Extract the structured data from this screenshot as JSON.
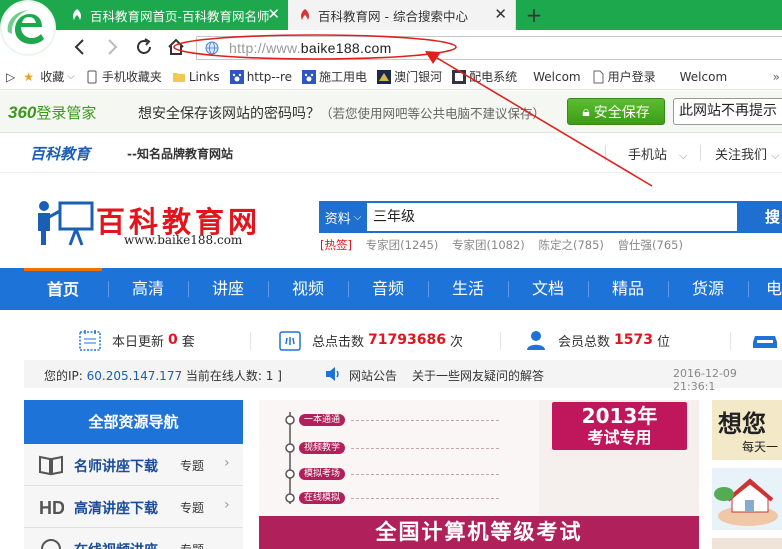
{
  "browser": {
    "tabs": [
      {
        "title": "百科教育网首页-百科教育网名师讲座",
        "active": true
      },
      {
        "title": "百科教育网 - 综合搜索中心",
        "active": false
      }
    ],
    "url_prefix": "http://www.",
    "url_domain": "baike188.com"
  },
  "bookmarks": [
    {
      "label": "收藏",
      "icon": "star-icon"
    },
    {
      "label": "手机收藏夹",
      "icon": "phone-icon"
    },
    {
      "label": "Links",
      "icon": "folder-icon"
    },
    {
      "label": "http--re",
      "icon": "paw-icon"
    },
    {
      "label": "施工用电",
      "icon": "paw-icon"
    },
    {
      "label": "澳门银河",
      "icon": "site-icon"
    },
    {
      "label": "配电系统",
      "icon": "site-icon"
    },
    {
      "label": "Welcom",
      "icon": ""
    },
    {
      "label": "用户登录",
      "icon": "page-icon"
    },
    {
      "label": "Welcom",
      "icon": ""
    }
  ],
  "password_bar": {
    "brand_num": "360",
    "brand_text": "登录管家",
    "question": "想安全保存该网站的密码吗？",
    "note": "（若您使用网吧等公共电脑不建议保存）",
    "save_label": "安全保存",
    "never_label": "此网站不再提示"
  },
  "site_header": {
    "brand": "百科教育",
    "slogan": "--知名品牌教育网站",
    "mobile": "手机站",
    "follow": "关注我们"
  },
  "logo": {
    "title": "百科教育网",
    "url": "www.baike188.com"
  },
  "search": {
    "category": "资料",
    "query": "三年级",
    "button": "搜",
    "hot_label": "[热签]",
    "hot_words": [
      "专家团(1245)",
      "专家团(1082)",
      "陈定之(785)",
      "曾仕强(765)"
    ]
  },
  "nav": [
    "首页",
    "高清",
    "讲座",
    "视频",
    "音频",
    "生活",
    "文档",
    "精品",
    "货源",
    "电"
  ],
  "stats": {
    "update_label": "本日更新",
    "update_num": "0",
    "update_unit": "套",
    "clicks_label": "总点击数",
    "clicks_num": "71793686",
    "clicks_unit": "次",
    "members_label": "会员总数",
    "members_num": "1573",
    "members_unit": "位"
  },
  "info": {
    "ip_label": "您的IP:",
    "ip_value": "60.205.147.177",
    "online": "当前在线人数: 1 ]",
    "notice_label": "网站公告",
    "notice_text": "关于一些网友疑问的解答",
    "timestamp": "2016-12-09 21:36:1"
  },
  "sidebar": {
    "title": "全部资源导航",
    "items": [
      {
        "label": "名师讲座下载",
        "tag": "专题"
      },
      {
        "label": "高清讲座下载",
        "tag": "专题"
      },
      {
        "label": "在线视频讲座",
        "tag": "专题"
      }
    ]
  },
  "banner": {
    "tags": [
      "一本通通",
      "视频教学",
      "模拟考场",
      "在线模拟"
    ],
    "year": "2013年",
    "special": "考试专用",
    "footer": "全国计算机等级考试"
  },
  "promo": {
    "title": "想您",
    "sub": "每天一"
  }
}
